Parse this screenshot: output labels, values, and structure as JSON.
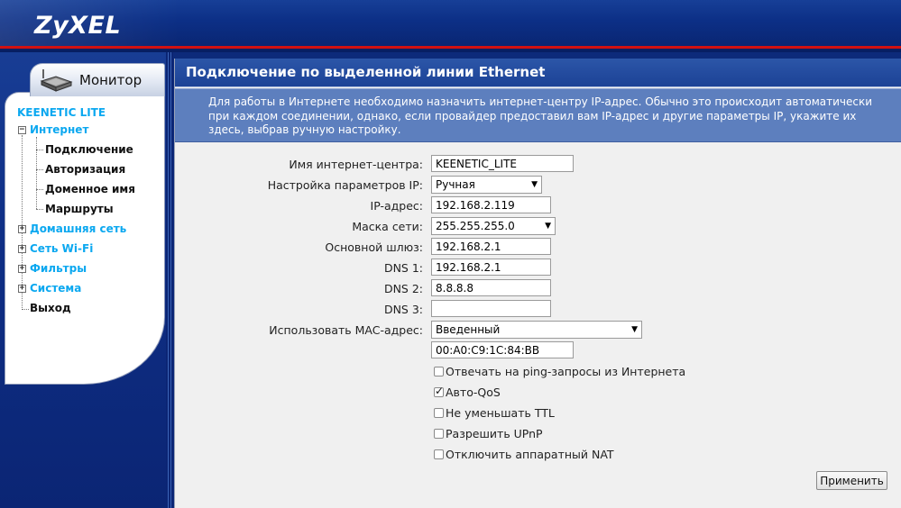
{
  "header": {
    "logo": "ZyXEL"
  },
  "sidebar": {
    "monitor_tab": "Монитор",
    "device_name": "KEENETIC LITE",
    "items": [
      {
        "label": "Интернет",
        "expanded": true
      },
      {
        "label": "Подключение"
      },
      {
        "label": "Авторизация"
      },
      {
        "label": "Доменное имя"
      },
      {
        "label": "Маршруты"
      },
      {
        "label": "Домашняя сеть",
        "expanded": false
      },
      {
        "label": "Сеть Wi-Fi",
        "expanded": false
      },
      {
        "label": "Фильтры",
        "expanded": false
      },
      {
        "label": "Система",
        "expanded": false
      },
      {
        "label": "Выход"
      }
    ]
  },
  "main": {
    "title": "Подключение по выделенной линии Ethernet",
    "description": "Для работы в Интернете необходимо назначить интернет-центру IP-адрес. Обычно это происходит автоматически при каждом соединении, однако, если провайдер предоставил вам IP-адрес и другие параметры IP, укажите их здесь, выбрав ручную настройку.",
    "form": {
      "hostname_label": "Имя интернет-центра:",
      "hostname_value": "KEENETIC_LITE",
      "ip_mode_label": "Настройка параметров IP:",
      "ip_mode_value": "Ручная",
      "ip_label": "IP-адрес:",
      "ip_value": "192.168.2.119",
      "mask_label": "Маска сети:",
      "mask_value": "255.255.255.0",
      "gateway_label": "Основной шлюз:",
      "gateway_value": "192.168.2.1",
      "dns1_label": "DNS 1:",
      "dns1_value": "192.168.2.1",
      "dns2_label": "DNS 2:",
      "dns2_value": "8.8.8.8",
      "dns3_label": "DNS 3:",
      "dns3_value": "",
      "mac_label": "Использовать MAC-адрес:",
      "mac_mode_value": "Введенный",
      "mac_value": "00:A0:C9:1C:84:BB"
    },
    "checkboxes": [
      {
        "label": "Отвечать на ping-запросы из Интернета",
        "checked": false
      },
      {
        "label": "Авто-QoS",
        "checked": true
      },
      {
        "label": "Не уменьшать TTL",
        "checked": false
      },
      {
        "label": "Разрешить UPnP",
        "checked": false
      },
      {
        "label": "Отключить аппаратный NAT",
        "checked": false
      }
    ],
    "apply_label": "Применить"
  },
  "colors": {
    "header_blue": "#0c2f86",
    "accent_red": "#d21111",
    "nav_section": "#0ba8f0",
    "desc_band": "#5d7fbe"
  },
  "icons": {
    "monitor_tab": "router-icon",
    "expand": "plus-box-icon",
    "collapse": "minus-box-icon",
    "dropdown": "triangle-down-icon",
    "checkbox": "checkmark-icon"
  }
}
